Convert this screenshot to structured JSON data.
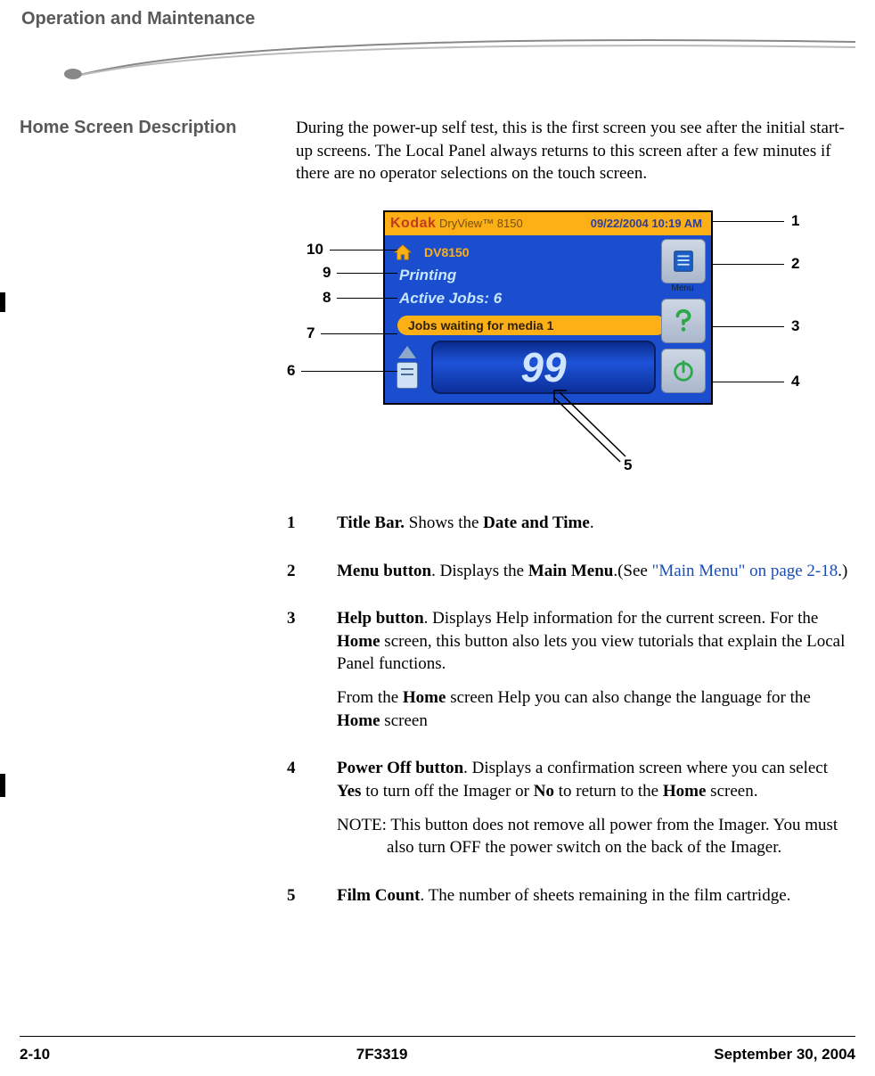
{
  "header": {
    "chapter_title": "Operation and Maintenance"
  },
  "section": {
    "heading": "Home Screen Description",
    "intro": "During the power-up self test, this is the first screen you see after the initial start-up screens. The Local Panel always returns to this screen after a few minutes if there are no operator selections on the touch screen."
  },
  "screen": {
    "brand": "Kodak",
    "brand_sub": "DryView™ 8150",
    "datetime": "09/22/2004 10:19 AM",
    "device_name": "DV8150",
    "state": "Printing",
    "active_jobs_label": "Active Jobs: 6",
    "status_msg": "Jobs waiting for media 1",
    "film_count": "99"
  },
  "callouts": {
    "c1": "1",
    "c2": "2",
    "c3": "3",
    "c4": "4",
    "c5": "5",
    "c6": "6",
    "c7": "7",
    "c8": "8",
    "c9": "9",
    "c10": "10"
  },
  "legend": {
    "i1": {
      "num": "1",
      "title": "Title Bar.",
      "rest": " Shows the ",
      "bold2": "Date and Time",
      "rest2": "."
    },
    "i2": {
      "num": "2",
      "title": "Menu button",
      "rest": ". Displays the ",
      "bold2": "Main Menu",
      "rest2": ".(See ",
      "link": "\"Main Menu\" on page 2-18",
      "rest3": ".)"
    },
    "i3": {
      "num": "3",
      "title": "Help button",
      "p1_a": ". Displays Help information for the current screen. For the ",
      "p1_b": "Home",
      "p1_c": " screen, this button also lets you view tutorials that explain the Local Panel functions.",
      "p2_a": "From the ",
      "p2_b": "Home",
      "p2_c": " screen Help you can also change the language for the ",
      "p2_d": "Home",
      "p2_e": " screen"
    },
    "i4": {
      "num": "4",
      "title": "Power Off button",
      "p1_a": ". Displays a confirmation screen where you can select ",
      "p1_b": "Yes",
      "p1_c": " to turn off the Imager or ",
      "p1_d": "No",
      "p1_e": " to return to the ",
      "p1_f": "Home",
      "p1_g": " screen.",
      "note_label": "NOTE:",
      "note_body": " This button does not remove all power from the Imager. You must also turn OFF the power switch on the back of the Imager."
    },
    "i5": {
      "num": "5",
      "title": "Film Count",
      "rest": ". The number of sheets remaining in the film cartridge."
    }
  },
  "footer": {
    "page": "2-10",
    "doc_id": "7F3319",
    "date": "September 30, 2004"
  }
}
